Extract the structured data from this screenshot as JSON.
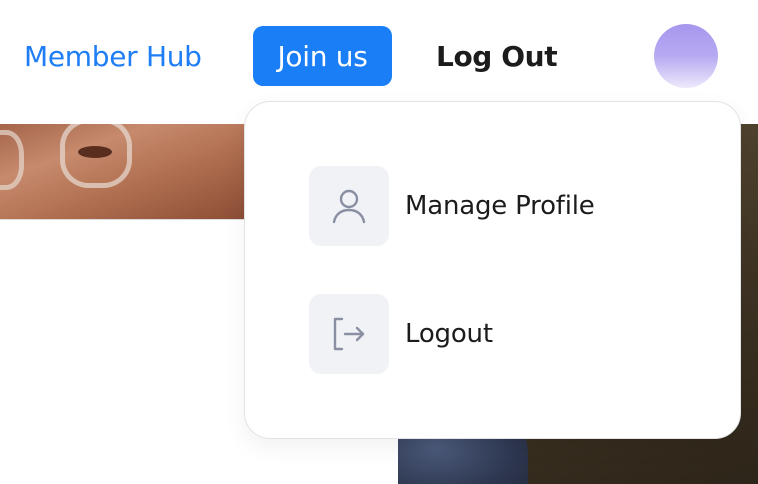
{
  "nav": {
    "member_hub": "Member Hub",
    "join_us": "Join us",
    "log_out": "Log Out"
  },
  "dropdown": {
    "items": [
      {
        "label": "Manage Profile",
        "icon": "user-icon"
      },
      {
        "label": "Logout",
        "icon": "logout-icon"
      }
    ]
  },
  "colors": {
    "accent": "#1a7ef6",
    "icon_bg": "#f1f2f6",
    "icon_stroke": "#8a8fa3"
  }
}
